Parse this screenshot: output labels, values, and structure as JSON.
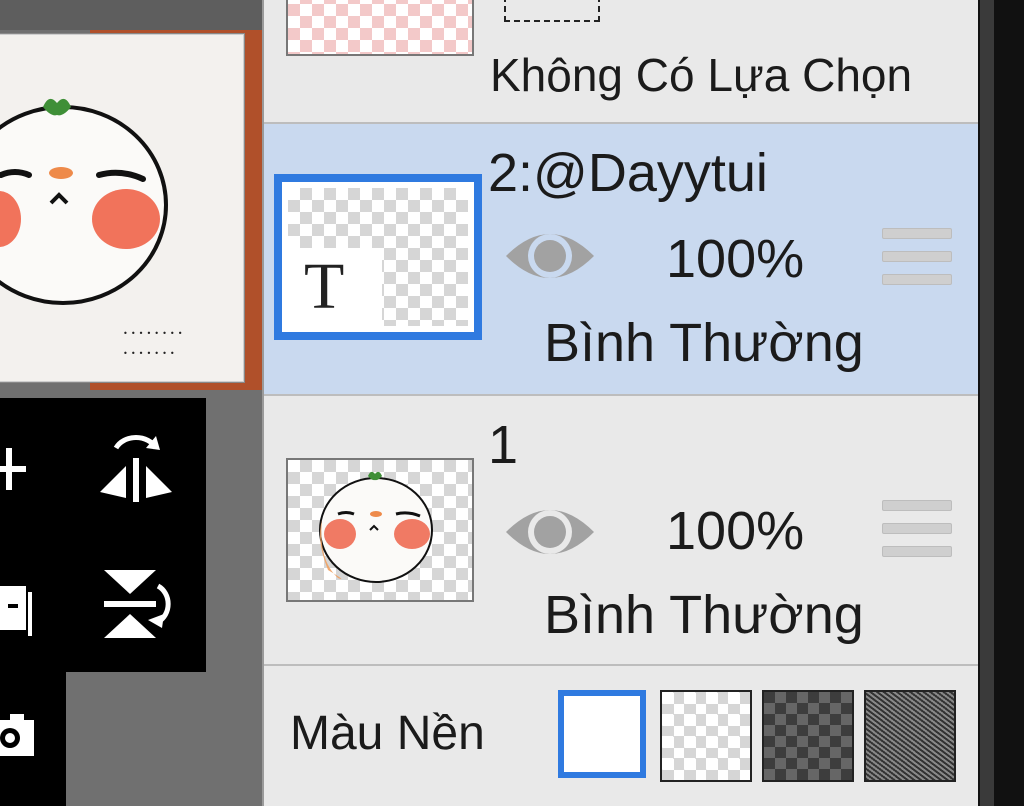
{
  "selection_layer": {
    "label": "Không Có Lựa Chọn"
  },
  "layers": [
    {
      "name": "2:@Dayytui",
      "opacity": "100%",
      "blend_mode": "Bình Thường",
      "selected": true,
      "thumb_glyph": "T",
      "visible_icon": "eye-icon"
    },
    {
      "name": "1",
      "opacity": "100%",
      "blend_mode": "Bình Thường",
      "selected": false,
      "visible_icon": "eye-icon"
    }
  ],
  "background_color": {
    "label": "Màu Nền",
    "options": [
      "white",
      "transparent",
      "dark-checker",
      "noise"
    ],
    "selected": "white"
  },
  "tools": [
    "add-layer-icon",
    "flip-horizontal-icon",
    "duplicate-layer-icon",
    "flip-vertical-icon",
    "camera-icon"
  ],
  "colors": {
    "accent": "#2f7ae0",
    "selected_row": "#c9d9ef",
    "panel": "#e9e9e9"
  }
}
